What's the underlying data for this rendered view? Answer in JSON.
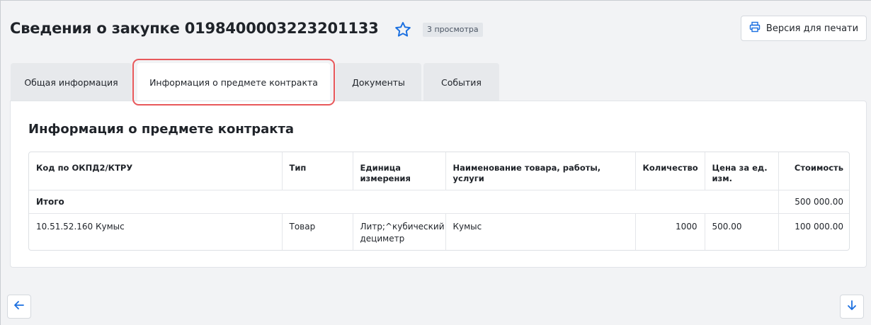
{
  "header": {
    "title": "Сведения о закупке 0198400003223201133",
    "views_badge": "3 просмотра",
    "print_button_label": "Версия для печати",
    "favorite_icon": "star-outline-icon",
    "print_icon": "printer-icon"
  },
  "tabs": [
    {
      "label": "Общая информация",
      "active": false
    },
    {
      "label": "Информация о предмете контракта",
      "active": true
    },
    {
      "label": "Документы",
      "active": false
    },
    {
      "label": "События",
      "active": false
    }
  ],
  "section": {
    "title": "Информация о предмете контракта"
  },
  "table": {
    "headers": [
      "Код по ОКПД2/КТРУ",
      "Тип",
      "Единица измерения",
      "Наименование товара, работы, услуги",
      "Количество",
      "Цена за ед. изм.",
      "Стоимость"
    ],
    "total_row": {
      "label": "Итого",
      "sum": "500 000.00"
    },
    "rows": [
      {
        "code": "10.51.52.160 Кумыс",
        "type": "Товар",
        "unit": "Литр;^кубический дециметр",
        "name": "Кумыс",
        "quantity": "1000",
        "price": "500.00",
        "cost": "100 000.00"
      }
    ]
  },
  "navigation": {
    "back_icon": "arrow-left-icon",
    "down_icon": "arrow-down-icon"
  },
  "colors": {
    "accent": "#1a6fe0",
    "highlight": "#e8585b"
  }
}
